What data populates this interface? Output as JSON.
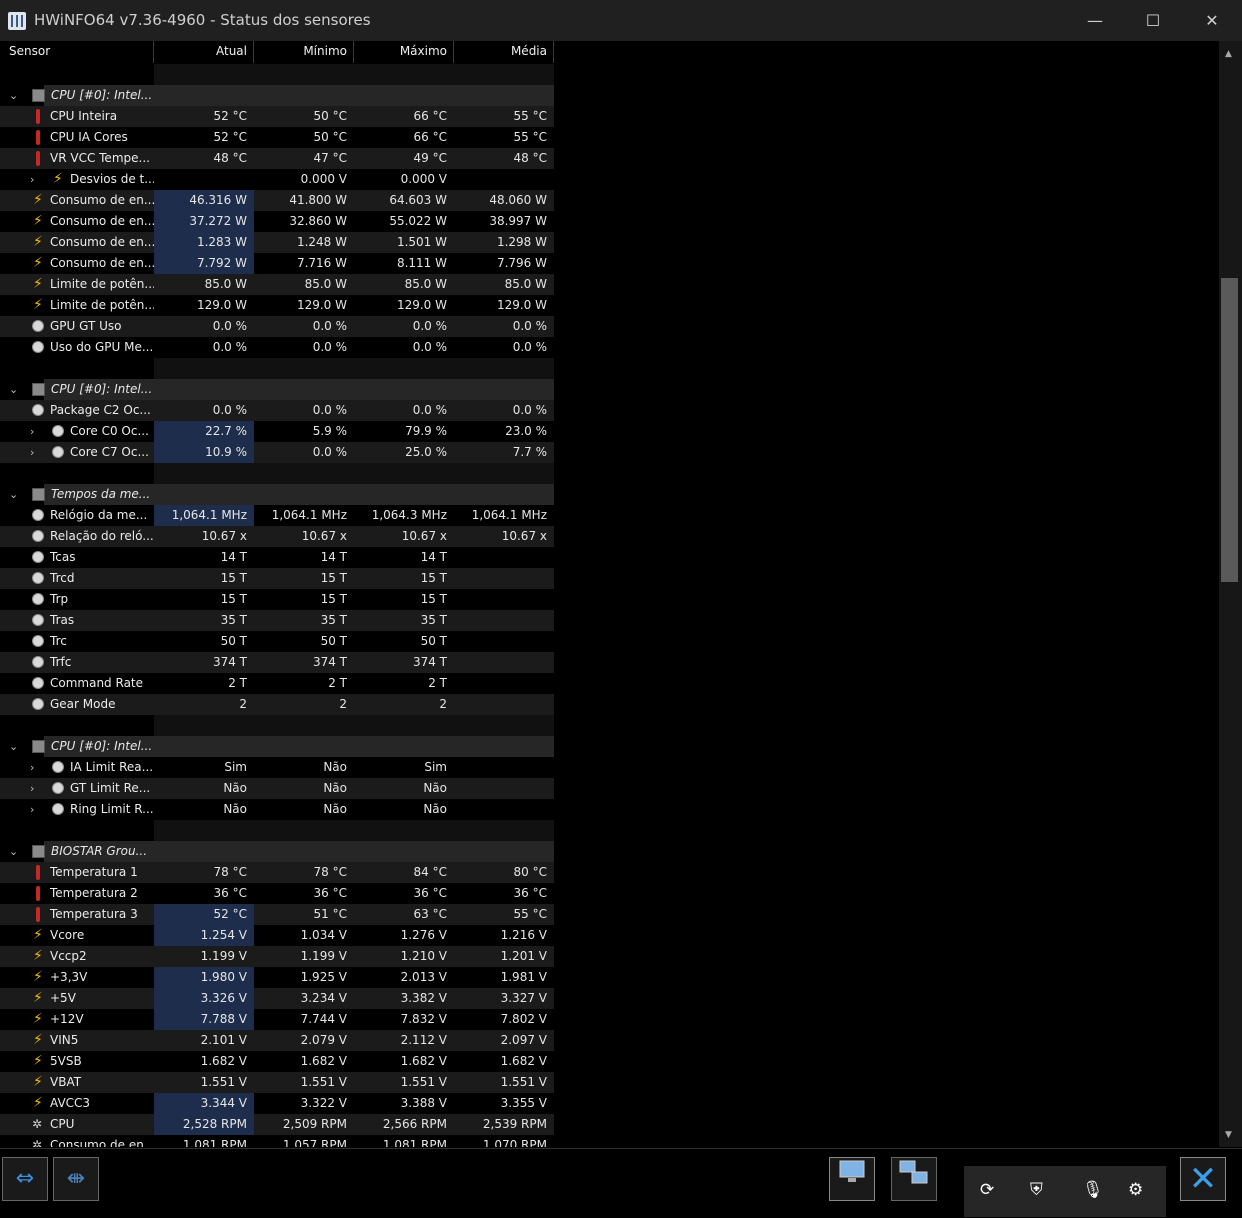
{
  "window": {
    "title": "HWiNFO64 v7.36-4960 - Status dos sensores",
    "minimize": "—",
    "maximize": "☐",
    "close": "✕"
  },
  "columns": [
    "Sensor",
    "Atual",
    "Mínimo",
    "Máximo",
    "Média"
  ],
  "rows": [
    {
      "kind": "gap"
    },
    {
      "kind": "group",
      "name": "CPU [#0]: Intel..."
    },
    {
      "kind": "sensor",
      "icon": "therm",
      "name": "CPU Inteira",
      "v": [
        "52 °C",
        "50 °C",
        "66 °C",
        "55 °C"
      ]
    },
    {
      "kind": "sensor",
      "icon": "therm",
      "name": "CPU IA Cores",
      "v": [
        "52 °C",
        "50 °C",
        "66 °C",
        "55 °C"
      ]
    },
    {
      "kind": "sensor",
      "icon": "therm",
      "name": "VR VCC Tempe...",
      "v": [
        "48 °C",
        "47 °C",
        "49 °C",
        "48 °C"
      ]
    },
    {
      "kind": "sensor",
      "icon": "bolt",
      "sub": true,
      "name": "Desvios de t...",
      "v": [
        "",
        "0.000 V",
        "0.000 V",
        ""
      ]
    },
    {
      "kind": "sensor",
      "icon": "bolt",
      "hl": true,
      "name": "Consumo de en...",
      "v": [
        "46.316 W",
        "41.800 W",
        "64.603 W",
        "48.060 W"
      ]
    },
    {
      "kind": "sensor",
      "icon": "bolt",
      "hl": true,
      "name": "Consumo de en...",
      "v": [
        "37.272 W",
        "32.860 W",
        "55.022 W",
        "38.997 W"
      ]
    },
    {
      "kind": "sensor",
      "icon": "bolt",
      "hl": true,
      "name": "Consumo de en...",
      "v": [
        "1.283 W",
        "1.248 W",
        "1.501 W",
        "1.298 W"
      ]
    },
    {
      "kind": "sensor",
      "icon": "bolt",
      "hl": true,
      "name": "Consumo de en...",
      "v": [
        "7.792 W",
        "7.716 W",
        "8.111 W",
        "7.796 W"
      ]
    },
    {
      "kind": "sensor",
      "icon": "bolt",
      "name": "Limite de potên...",
      "v": [
        "85.0 W",
        "85.0 W",
        "85.0 W",
        "85.0 W"
      ]
    },
    {
      "kind": "sensor",
      "icon": "bolt",
      "name": "Limite de potên...",
      "v": [
        "129.0 W",
        "129.0 W",
        "129.0 W",
        "129.0 W"
      ]
    },
    {
      "kind": "sensor",
      "icon": "clock",
      "name": "GPU GT Uso",
      "v": [
        "0.0 %",
        "0.0 %",
        "0.0 %",
        "0.0 %"
      ]
    },
    {
      "kind": "sensor",
      "icon": "clock",
      "name": "Uso do GPU Me...",
      "v": [
        "0.0 %",
        "0.0 %",
        "0.0 %",
        "0.0 %"
      ]
    },
    {
      "kind": "gap"
    },
    {
      "kind": "group",
      "name": "CPU [#0]: Intel..."
    },
    {
      "kind": "sensor",
      "icon": "clock",
      "name": "Package C2 Oc...",
      "v": [
        "0.0 %",
        "0.0 %",
        "0.0 %",
        "0.0 %"
      ]
    },
    {
      "kind": "sensor",
      "icon": "clock",
      "sub": true,
      "hl": true,
      "name": "Core C0 Oc...",
      "v": [
        "22.7 %",
        "5.9 %",
        "79.9 %",
        "23.0 %"
      ]
    },
    {
      "kind": "sensor",
      "icon": "clock",
      "sub": true,
      "hl": true,
      "name": "Core C7 Oc...",
      "v": [
        "10.9 %",
        "0.0 %",
        "25.0 %",
        "7.7 %"
      ]
    },
    {
      "kind": "gap"
    },
    {
      "kind": "group",
      "name": "Tempos da me..."
    },
    {
      "kind": "sensor",
      "icon": "clock",
      "hl": true,
      "name": "Relógio da me...",
      "v": [
        "1,064.1 MHz",
        "1,064.1 MHz",
        "1,064.3 MHz",
        "1,064.1 MHz"
      ]
    },
    {
      "kind": "sensor",
      "icon": "clock",
      "name": "Relação do reló...",
      "v": [
        "10.67 x",
        "10.67 x",
        "10.67 x",
        "10.67 x"
      ]
    },
    {
      "kind": "sensor",
      "icon": "clock",
      "name": "Tcas",
      "v": [
        "14 T",
        "14 T",
        "14 T",
        ""
      ]
    },
    {
      "kind": "sensor",
      "icon": "clock",
      "name": "Trcd",
      "v": [
        "15 T",
        "15 T",
        "15 T",
        ""
      ]
    },
    {
      "kind": "sensor",
      "icon": "clock",
      "name": "Trp",
      "v": [
        "15 T",
        "15 T",
        "15 T",
        ""
      ]
    },
    {
      "kind": "sensor",
      "icon": "clock",
      "name": "Tras",
      "v": [
        "35 T",
        "35 T",
        "35 T",
        ""
      ]
    },
    {
      "kind": "sensor",
      "icon": "clock",
      "name": "Trc",
      "v": [
        "50 T",
        "50 T",
        "50 T",
        ""
      ]
    },
    {
      "kind": "sensor",
      "icon": "clock",
      "name": "Trfc",
      "v": [
        "374 T",
        "374 T",
        "374 T",
        ""
      ]
    },
    {
      "kind": "sensor",
      "icon": "clock",
      "name": "Command Rate",
      "v": [
        "2 T",
        "2 T",
        "2 T",
        ""
      ]
    },
    {
      "kind": "sensor",
      "icon": "clock",
      "name": "Gear Mode",
      "v": [
        "2",
        "2",
        "2",
        ""
      ]
    },
    {
      "kind": "gap"
    },
    {
      "kind": "group",
      "name": "CPU [#0]: Intel..."
    },
    {
      "kind": "sensor",
      "icon": "clock",
      "sub": true,
      "name": "IA Limit Rea...",
      "v": [
        "Sim",
        "Não",
        "Sim",
        ""
      ]
    },
    {
      "kind": "sensor",
      "icon": "clock",
      "sub": true,
      "name": "GT Limit Re...",
      "v": [
        "Não",
        "Não",
        "Não",
        ""
      ]
    },
    {
      "kind": "sensor",
      "icon": "clock",
      "sub": true,
      "name": "Ring Limit R...",
      "v": [
        "Não",
        "Não",
        "Não",
        ""
      ]
    },
    {
      "kind": "gap"
    },
    {
      "kind": "group",
      "name": "BIOSTAR Grou..."
    },
    {
      "kind": "sensor",
      "icon": "therm",
      "name": "Temperatura 1",
      "v": [
        "78 °C",
        "78 °C",
        "84 °C",
        "80 °C"
      ]
    },
    {
      "kind": "sensor",
      "icon": "therm",
      "name": "Temperatura 2",
      "v": [
        "36 °C",
        "36 °C",
        "36 °C",
        "36 °C"
      ]
    },
    {
      "kind": "sensor",
      "icon": "therm",
      "hl": true,
      "name": "Temperatura 3",
      "v": [
        "52 °C",
        "51 °C",
        "63 °C",
        "55 °C"
      ]
    },
    {
      "kind": "sensor",
      "icon": "bolt",
      "hl": true,
      "name": "Vcore",
      "v": [
        "1.254 V",
        "1.034 V",
        "1.276 V",
        "1.216 V"
      ]
    },
    {
      "kind": "sensor",
      "icon": "bolt",
      "name": "Vccp2",
      "v": [
        "1.199 V",
        "1.199 V",
        "1.210 V",
        "1.201 V"
      ]
    },
    {
      "kind": "sensor",
      "icon": "bolt",
      "hl": true,
      "name": "+3,3V",
      "v": [
        "1.980 V",
        "1.925 V",
        "2.013 V",
        "1.981 V"
      ]
    },
    {
      "kind": "sensor",
      "icon": "bolt",
      "hl": true,
      "name": "+5V",
      "v": [
        "3.326 V",
        "3.234 V",
        "3.382 V",
        "3.327 V"
      ]
    },
    {
      "kind": "sensor",
      "icon": "bolt",
      "hl": true,
      "name": "+12V",
      "v": [
        "7.788 V",
        "7.744 V",
        "7.832 V",
        "7.802 V"
      ]
    },
    {
      "kind": "sensor",
      "icon": "bolt",
      "name": "VIN5",
      "v": [
        "2.101 V",
        "2.079 V",
        "2.112 V",
        "2.097 V"
      ]
    },
    {
      "kind": "sensor",
      "icon": "bolt",
      "name": "5VSB",
      "v": [
        "1.682 V",
        "1.682 V",
        "1.682 V",
        "1.682 V"
      ]
    },
    {
      "kind": "sensor",
      "icon": "bolt",
      "name": "VBAT",
      "v": [
        "1.551 V",
        "1.551 V",
        "1.551 V",
        "1.551 V"
      ]
    },
    {
      "kind": "sensor",
      "icon": "bolt",
      "hl": true,
      "name": "AVCC3",
      "v": [
        "3.344 V",
        "3.322 V",
        "3.388 V",
        "3.355 V"
      ]
    },
    {
      "kind": "sensor",
      "icon": "fan",
      "hl": true,
      "name": "CPU",
      "v": [
        "2,528 RPM",
        "2,509 RPM",
        "2,566 RPM",
        "2,539 RPM"
      ]
    },
    {
      "kind": "sensor",
      "icon": "fan",
      "name": "Consumo de en...",
      "v": [
        "1,081 RPM",
        "1,057 RPM",
        "1,081 RPM",
        "1,070 RPM"
      ]
    }
  ],
  "toolbar": {
    "nav_arrows": "⇔",
    "collapse": "⇼"
  },
  "tray_icons": [
    "refresh-icon",
    "shield-warning-icon",
    "microphone-icon",
    "steam-icon"
  ]
}
